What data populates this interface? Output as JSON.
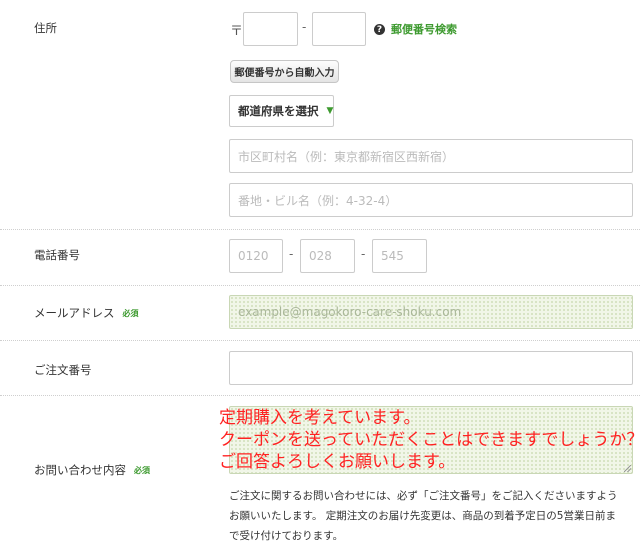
{
  "address": {
    "label": "住所",
    "zip_mark": "〒",
    "zip_separator": "-",
    "zip1_value": "",
    "zip2_value": "",
    "zip_search_link": "郵便番号検索",
    "help_icon": "?",
    "autofill_button": "郵便番号から自動入力",
    "prefecture_select": "都道府県を選択",
    "caret_icon": "▼",
    "city_placeholder": "市区町村名（例：東京都新宿区西新宿）",
    "street_placeholder": "番地・ビル名（例：4-32-4）"
  },
  "phone": {
    "label": "電話番号",
    "part1_placeholder": "0120",
    "part2_placeholder": "028",
    "part3_placeholder": "545",
    "separator": "-"
  },
  "email": {
    "label": "メールアドレス",
    "required_badge": "必須",
    "placeholder": "example@magokoro-care-shoku.com"
  },
  "order_number": {
    "label": "ご注文番号",
    "value": ""
  },
  "inquiry": {
    "label": "お問い合わせ内容",
    "required_badge": "必須",
    "text_lines": [
      "定期購入を考えています。",
      "クーポンを送っていただくことはできますでしょうか？",
      "ご回答よろしくお願いします。"
    ],
    "note_lines": [
      "ご注文に関するお問い合わせには、必ず「ご注文番号」をご記入くださいますよう",
      "お願いいたします。 定期注文のお届け先変更は、商品の到着予定日の5営業日前ま",
      "で受け付けております。"
    ]
  },
  "colors": {
    "accent_green": "#3d9a2f",
    "inquiry_text_red": "#ff2222",
    "field_border": "#cccccc"
  }
}
